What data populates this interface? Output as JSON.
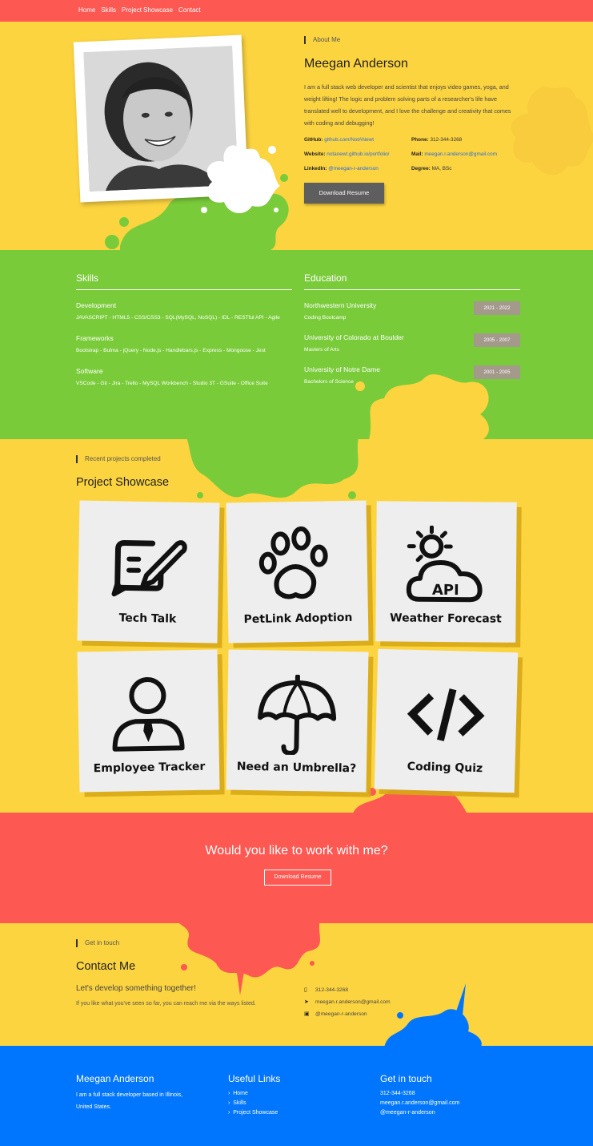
{
  "nav": {
    "items": [
      "Home",
      "Skills",
      "Project Showcase",
      "Contact"
    ]
  },
  "about": {
    "eyebrow": "About Me",
    "name": "Meegan Anderson",
    "bio": "I am a full stack web developer and scientist that enjoys video games, yoga, and weight lifting! The logic and problem solving parts of a researcher's life have translated well to development, and I love the challenge and creativity that comes with coding and debugging!",
    "github_label": "GitHub:",
    "github_value": "github.com/NotANewt",
    "phone_label": "Phone:",
    "phone_value": "312-344-3268",
    "website_label": "Website:",
    "website_value": "notanewt.github.io/portfolio/",
    "mail_label": "Mail:",
    "mail_value": "meegan.r.anderson@gmail.com",
    "linkedin_label": "LinkedIn:",
    "linkedin_value": "@meegan-r-anderson",
    "degree_label": "Degree:",
    "degree_value": "MA, BSc",
    "resume_button": "Download Resume"
  },
  "skills": {
    "title": "Skills",
    "groups": [
      {
        "name": "Development",
        "items": "JAVASCRIPT - HTML5 - CSS/CSS3 - SQL(MySQL, NoSQL) - IDL - RESTful API - Agile"
      },
      {
        "name": "Frameworks",
        "items": "Bootstrap - Bulma - jQuery - Node.js - Handlebars.js - Express - Mongoose - Jest"
      },
      {
        "name": "Software",
        "items": "VSCode - Git - Jira - Trello - MySQL Workbench - Studio 3T - GSuite - Office Suite"
      }
    ]
  },
  "education": {
    "title": "Education",
    "items": [
      {
        "school": "Northwestern University",
        "degree": "Coding Bootcamp",
        "years": "2021 - 2022"
      },
      {
        "school": "University of Colorado at Boulder",
        "degree": "Masters of Arts",
        "years": "2005 - 2007"
      },
      {
        "school": "University of Notre Dame",
        "degree": "Bachelors of Science",
        "years": "2001 - 2005"
      }
    ]
  },
  "projects": {
    "eyebrow": "Recent projects completed",
    "title": "Project Showcase",
    "cards": [
      {
        "label": "Tech Talk",
        "icon": "chat-pen-icon"
      },
      {
        "label": "PetLink Adoption",
        "icon": "paw-icon"
      },
      {
        "label": "Weather Forecast",
        "icon": "weather-api-icon",
        "icon_text": "API"
      },
      {
        "label": "Employee Tracker",
        "icon": "employee-icon"
      },
      {
        "label": "Need an Umbrella?",
        "icon": "umbrella-icon"
      },
      {
        "label": "Coding Quiz",
        "icon": "code-icon"
      }
    ]
  },
  "cta": {
    "text": "Would you like to work with me?",
    "button": "Download Resume"
  },
  "contact": {
    "eyebrow": "Get in touch",
    "title": "Contact Me",
    "subtitle": "Let's develop something together!",
    "text": "If you like what you've seen so far, you can reach me via the ways listed.",
    "phone": "312-344-3268",
    "email": "meegan.r.anderson@gmail.com",
    "linkedin": "@meegan-r-anderson"
  },
  "footer": {
    "name": "Meegan Anderson",
    "bio": "I am a full stack developer based in Illinois, United States.",
    "links_title": "Useful Links",
    "links": [
      "Home",
      "Skills",
      "Project Showcase"
    ],
    "touch_title": "Get in touch",
    "phone": "312-344-3268",
    "email": "meegan.r.anderson@gmail.com",
    "linkedin": "@meegan-r-anderson"
  },
  "colors": {
    "yellow": "#fcd440",
    "red": "#fe5852",
    "green": "#7acb3a",
    "blue": "#0076fe",
    "gray": "#5e5e5e"
  }
}
